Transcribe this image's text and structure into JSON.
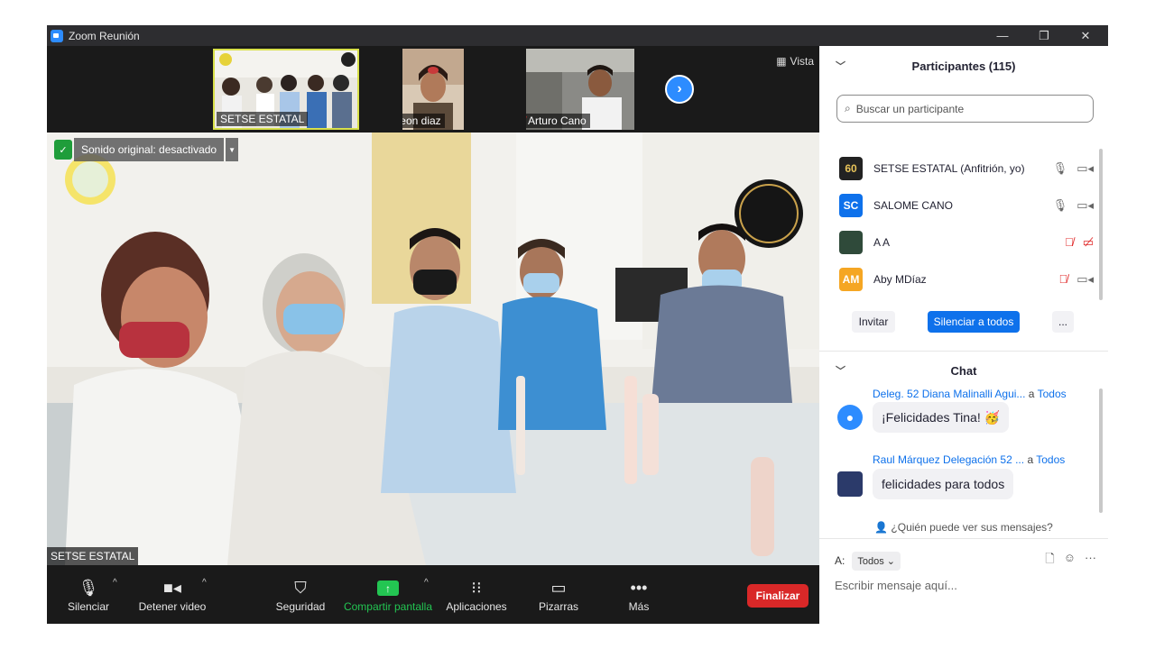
{
  "window": {
    "title": "Zoom Reunión",
    "minimize": "—",
    "restore": "❐",
    "close": "✕"
  },
  "thumbnails": [
    {
      "name": "SETSE ESTATAL",
      "muted": false
    },
    {
      "name": "Erika leon diaz",
      "muted": true
    },
    {
      "name": "Arturo Cano",
      "muted": true
    }
  ],
  "view_button": {
    "label": "Vista"
  },
  "main_video": {
    "sound_notice": "Sonido original: desactivado",
    "speaker_name": "SETSE ESTATAL"
  },
  "toolbar": {
    "mute": "Silenciar",
    "stop_video": "Detener video",
    "security": "Seguridad",
    "share": "Compartir pantalla",
    "apps": "Aplicaciones",
    "whiteboards": "Pizarras",
    "more": "Más",
    "end": "Finalizar"
  },
  "participants_panel": {
    "title": "Participantes (115)",
    "search_placeholder": "Buscar un participante",
    "list": [
      {
        "name": "SETSE ESTATAL (Anfitrión, yo)",
        "initials": "60",
        "color": "#222222",
        "mic_off": false,
        "cam_off": false
      },
      {
        "name": "SALOME CANO",
        "initials": "SC",
        "color": "#0e71eb",
        "mic_off": false,
        "cam_off": false
      },
      {
        "name": "A A",
        "initials": "",
        "color": "#2f4a3a",
        "mic_off": true,
        "cam_off": true
      },
      {
        "name": "Aby MDíaz",
        "initials": "AM",
        "color": "#f5a623",
        "mic_off": true,
        "cam_off": false
      }
    ],
    "invite": "Invitar",
    "mute_all": "Silenciar a todos",
    "more": "..."
  },
  "chat": {
    "title": "Chat",
    "messages": [
      {
        "sender": "Deleg. 52 Diana Malinalli Agui...",
        "to": "a",
        "recipient": "Todos",
        "text": "¡Felicidades Tina! 🥳"
      },
      {
        "sender": "Raul Márquez Delegación 52 ...",
        "to": "a",
        "recipient": "Todos",
        "text": "felicidades para todos"
      }
    ],
    "who_sees": "¿Quién puede ver sus mensajes?",
    "to_label": "A:",
    "to_value": "Todos",
    "compose_placeholder": "Escribir mensaje aquí..."
  },
  "colors": {
    "zoom_blue": "#2d8cff",
    "end_red": "#d92828",
    "share_green": "#23c552"
  }
}
